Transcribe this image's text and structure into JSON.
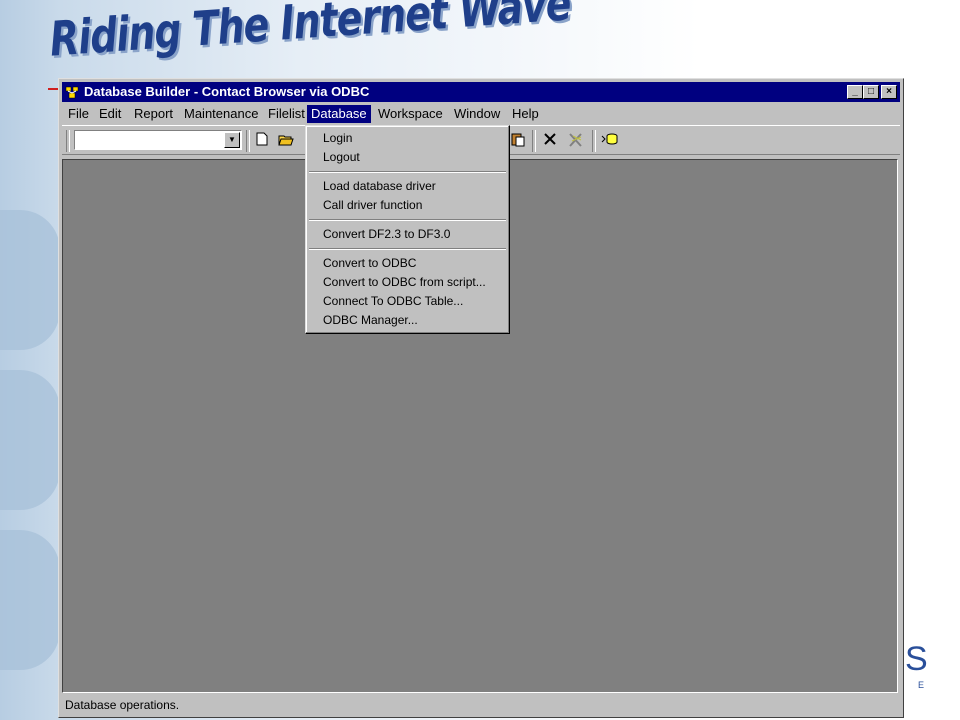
{
  "slide": {
    "title": "Riding The Internet Wave",
    "logo_text": "S",
    "logo_sub": "E"
  },
  "window": {
    "title": "Database Builder - Contact Browser via ODBC",
    "buttons": {
      "minimize": "_",
      "maximize": "□",
      "close": "×"
    }
  },
  "menubar": {
    "items": [
      "File",
      "Edit",
      "Report",
      "Maintenance",
      "Filelist",
      "Database",
      "Workspace",
      "Window",
      "Help"
    ],
    "active": "Database"
  },
  "toolbar": {
    "combo_value": ""
  },
  "dropdown": {
    "groups": [
      [
        "Login",
        "Logout"
      ],
      [
        "Load database driver",
        "Call driver function"
      ],
      [
        "Convert DF2.3 to DF3.0"
      ],
      [
        "Convert to ODBC",
        "Convert to ODBC from script...",
        "Connect To ODBC Table...",
        "ODBC Manager..."
      ]
    ]
  },
  "status": {
    "text": "Database operations."
  },
  "colors": {
    "titlebar": "#000080",
    "window_face": "#c0c0c0",
    "client_area": "#808080"
  }
}
